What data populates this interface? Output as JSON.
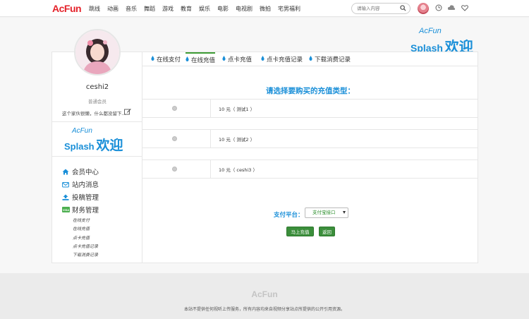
{
  "topnav": {
    "logo": "AcFun",
    "items": [
      "跳线",
      "动画",
      "音乐",
      "舞蹈",
      "游戏",
      "教育",
      "娱乐",
      "电影",
      "电视剧",
      "微拍",
      "宅男福利"
    ],
    "search_placeholder": "请输入内容",
    "icons": [
      "search-icon",
      "user-avatar",
      "clock-icon",
      "upload-cloud-icon",
      "heart-icon"
    ]
  },
  "banner": {
    "acfun": "AcFun",
    "splash": "Splash",
    "huanying": "欢迎"
  },
  "sidebar": {
    "username": "ceshi2",
    "level": "普通会员",
    "signature": "这个家伙很懒，什么都没留下...",
    "splash": {
      "acfun": "AcFun",
      "splash": "Splash",
      "huanying": "欢迎"
    },
    "menu": [
      {
        "label": "会员中心",
        "icon": "home-icon"
      },
      {
        "label": "站内消息",
        "icon": "envelope-icon"
      },
      {
        "label": "投稿管理",
        "icon": "upload-icon"
      },
      {
        "label": "财务管理",
        "icon": "visa-card-icon"
      }
    ],
    "submenu": [
      "在线支付",
      "在线充值",
      "点卡充值",
      "点卡充值记录",
      "下载消费记录"
    ]
  },
  "tabs": [
    {
      "label": "在线支付",
      "active": false
    },
    {
      "label": "在线充值",
      "active": true
    },
    {
      "label": "点卡充值",
      "active": false
    },
    {
      "label": "点卡充值记录",
      "active": false
    },
    {
      "label": "下载消费记录",
      "active": false
    }
  ],
  "main": {
    "heading": "请选择要购买的充值类型：",
    "options": [
      "10 元（ 测试1 ）",
      "10 元（ 测试2 ）",
      "10 元（ ceshi3 ）"
    ],
    "pay_label": "支付平台：",
    "pay_selected": "支付宝接口",
    "recharge_button": "马上充值",
    "back_button": "返回"
  },
  "footer": {
    "logo": "AcFun",
    "text": "本站不提供任何视听上传服务，所有内容均来自视频分享站点所提供的公开引用资源。"
  },
  "colors": {
    "brand_red": "#e4222a",
    "accent_blue": "#1a8fd8",
    "button_green": "#3b8e3b"
  }
}
